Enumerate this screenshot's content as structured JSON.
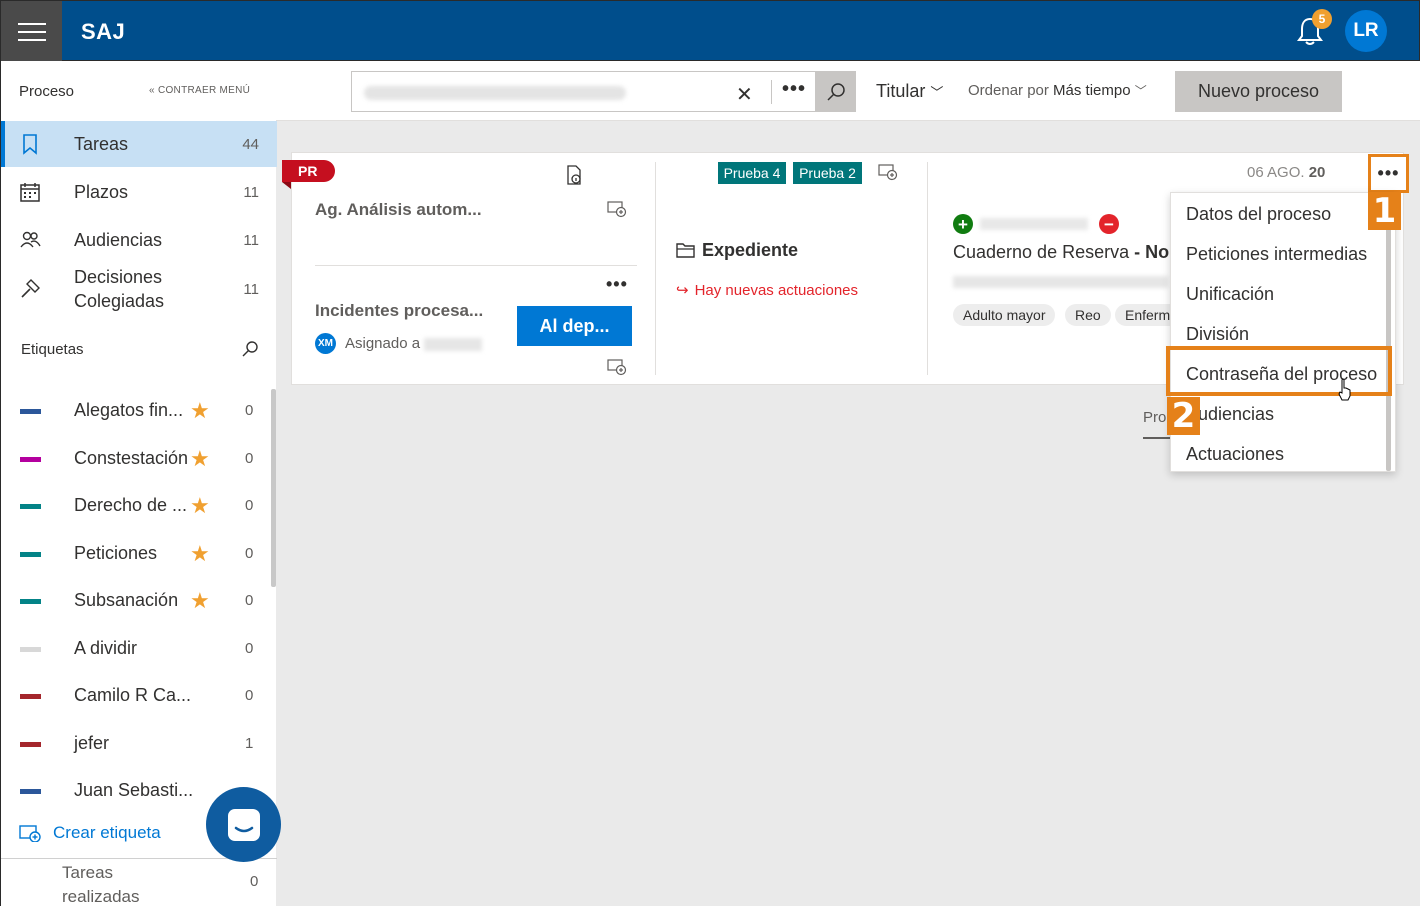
{
  "app": {
    "brand": "SAJ",
    "notifications_count": "5",
    "user_initials": "LR"
  },
  "sidebar": {
    "section_title": "Proceso",
    "collapse_label": "CONTRAER MENÚ",
    "nav": [
      {
        "label": "Tareas",
        "count": "44",
        "icon": "bookmark-icon"
      },
      {
        "label": "Plazos",
        "count": "11",
        "icon": "calendar-icon"
      },
      {
        "label": "Audiencias",
        "count": "11",
        "icon": "people-icon"
      },
      {
        "label": "Decisiones Colegiadas",
        "count": "11",
        "icon": "gavel-icon"
      }
    ],
    "tags_title": "Etiquetas",
    "tags": [
      {
        "label": "Alegatos fin...",
        "count": "0",
        "color": "#2b579a",
        "star": true
      },
      {
        "label": "Constestación",
        "count": "0",
        "color": "#b4009e",
        "star": true
      },
      {
        "label": "Derecho de ...",
        "count": "0",
        "color": "#038387",
        "star": true
      },
      {
        "label": "Peticiones",
        "count": "0",
        "color": "#038387",
        "star": true
      },
      {
        "label": "Subsanación",
        "count": "0",
        "color": "#038387",
        "star": true
      },
      {
        "label": "A dividir",
        "count": "0",
        "color": "#d8d8d8",
        "star": false
      },
      {
        "label": "Camilo R Ca...",
        "count": "0",
        "color": "#a4262c",
        "star": false
      },
      {
        "label": "jefer",
        "count": "1",
        "color": "#a4262c",
        "star": false
      },
      {
        "label": "Juan Sebasti...",
        "count": "",
        "color": "#2b579a",
        "star": false
      }
    ],
    "create_tag": "Crear etiqueta",
    "tasks_done_label": "Tareas realizadas",
    "tasks_done_count": "0"
  },
  "toolbar": {
    "filter_label": "Titular",
    "sort_prefix": "Ordenar por",
    "sort_value": "Más tiempo",
    "new_button": "Nuevo proceso"
  },
  "card": {
    "badge": "PR",
    "title1": "Ag. Análisis autom...",
    "title2": "Incidentes procesa...",
    "assignee_initials": "XM",
    "assigned_label": "Asignado a",
    "action_button": "Al dep...",
    "tags": [
      "Prueba 4",
      "Prueba 2"
    ],
    "expediente_label": "Expediente",
    "new_actions": "Hay nuevas actuaciones",
    "date_prefix": "06 AGO.",
    "date_suffix": "20",
    "cuaderno_prefix": "Cuaderno de Reserva",
    "cuaderno_suffix": " - No e",
    "chips": [
      "Adulto mayor",
      "Reo",
      "Enferm"
    ]
  },
  "menu": {
    "items": [
      "Datos del proceso",
      "Peticiones intermedias",
      "Unificación",
      "División",
      "Contraseña del proceso",
      "udiencias",
      "Actuaciones"
    ]
  },
  "annotations": {
    "step1": "1",
    "step2": "2"
  },
  "background_partial": "Pro",
  "colors": {
    "brand": "#004e8c",
    "accent": "#0078d4",
    "highlight": "#e58119",
    "star": "#f0a030"
  }
}
